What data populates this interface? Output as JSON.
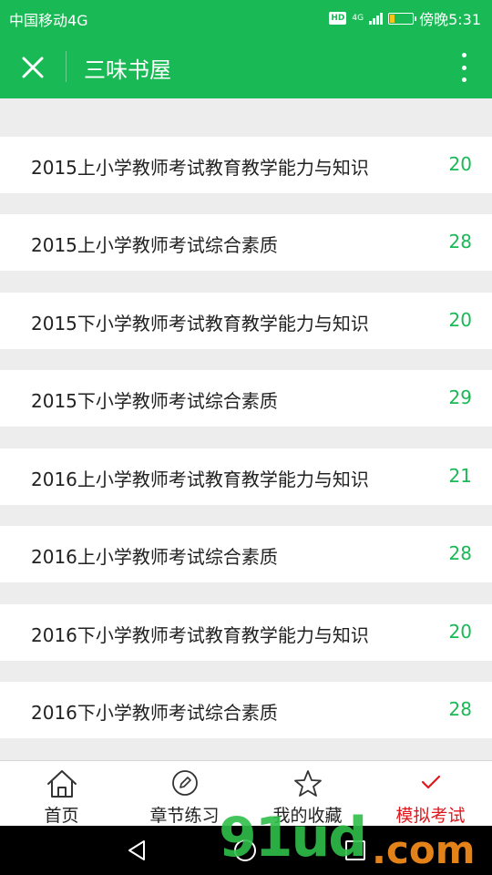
{
  "status_bar": {
    "carrier": "中国移动4G",
    "hd": "HD",
    "network": "4G",
    "time": "傍晚5:31"
  },
  "header": {
    "title": "三味书屋",
    "close_icon": "close-icon",
    "more_icon": "more-vertical-icon"
  },
  "exam_list": [
    {
      "name": "2015上小学教师考试教育教学能力与知识",
      "count": "20"
    },
    {
      "name": "2015上小学教师考试综合素质",
      "count": "28"
    },
    {
      "name": "2015下小学教师考试教育教学能力与知识",
      "count": "20"
    },
    {
      "name": "2015下小学教师考试综合素质",
      "count": "29"
    },
    {
      "name": "2016上小学教师考试教育教学能力与知识",
      "count": "21"
    },
    {
      "name": "2016上小学教师考试综合素质",
      "count": "28"
    },
    {
      "name": "2016下小学教师考试教育教学能力与知识",
      "count": "20"
    },
    {
      "name": "2016下小学教师考试综合素质",
      "count": "28"
    }
  ],
  "tab_bar": {
    "tabs": [
      {
        "label": "首页",
        "icon": "home-icon",
        "active": false
      },
      {
        "label": "章节练习",
        "icon": "pencil-icon",
        "active": false
      },
      {
        "label": "我的收藏",
        "icon": "star-icon",
        "active": false
      },
      {
        "label": "模拟考试",
        "icon": "checkmark-icon",
        "active": true
      }
    ]
  },
  "colors": {
    "brand_green": "#19b955",
    "active_red": "#e0181e",
    "count_green": "#19b955"
  },
  "watermark": {
    "logo": "91ud.com"
  }
}
